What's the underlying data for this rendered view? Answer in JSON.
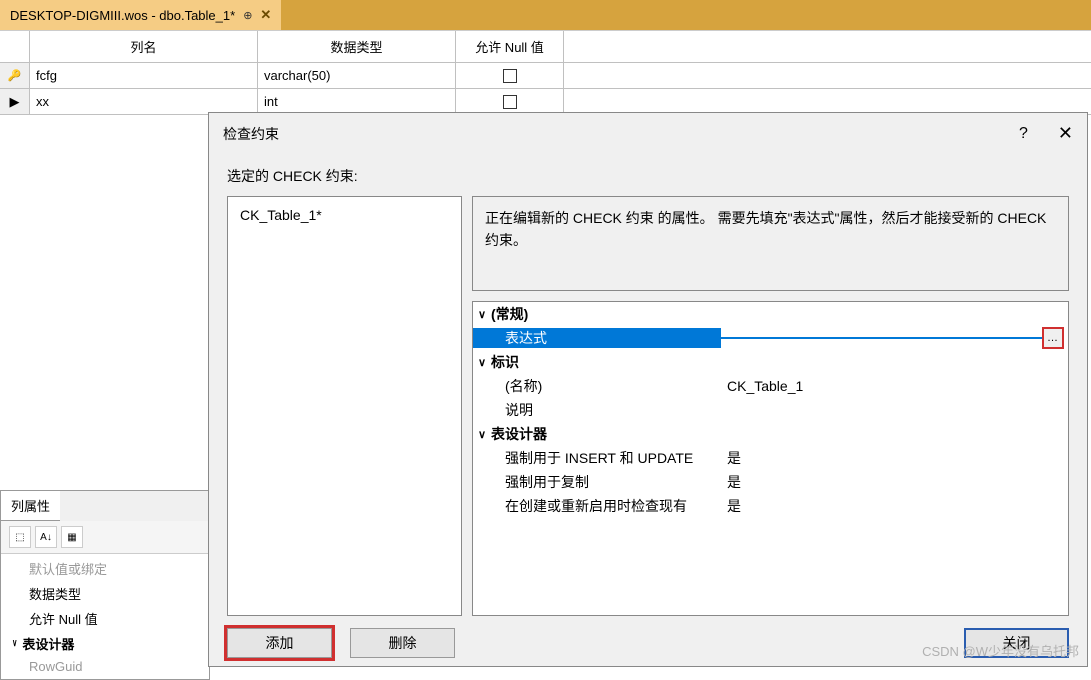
{
  "tab": {
    "title": "DESKTOP-DIGMIII.wos - dbo.Table_1*",
    "pin_glyph": "⊕",
    "close_glyph": "✕"
  },
  "grid": {
    "headers": {
      "name": "列名",
      "type": "数据类型",
      "null": "允许 Null 值"
    },
    "rows": [
      {
        "selector": "key",
        "name": "fcfg",
        "type": "varchar(50)",
        "null": false
      },
      {
        "selector": "arrow",
        "name": "xx",
        "type": "int",
        "null": false
      }
    ]
  },
  "col_props": {
    "tab_label": "列属性",
    "toolbar": {
      "cat_glyph": "⬚",
      "sort_glyph": "A↓",
      "pages_glyph": "▦"
    },
    "items": [
      {
        "label": "默认值或绑定",
        "kind": "disabled"
      },
      {
        "label": "数据类型",
        "kind": "normal"
      },
      {
        "label": "允许 Null 值",
        "kind": "normal"
      },
      {
        "label": "表设计器",
        "kind": "group"
      },
      {
        "label": "RowGuid",
        "kind": "disabled"
      }
    ]
  },
  "dialog": {
    "title": "检查约束",
    "help_glyph": "?",
    "close_glyph": "✕",
    "section_label": "选定的 CHECK 约束:",
    "constraint_items": [
      "CK_Table_1*"
    ],
    "description": "正在编辑新的 CHECK 约束 的属性。  需要先填充\"表达式\"属性，然后才能接受新的 CHECK 约束。",
    "props": [
      {
        "type": "group",
        "label": "(常规)"
      },
      {
        "type": "selected",
        "label": "表达式",
        "value": ""
      },
      {
        "type": "group",
        "label": "标识"
      },
      {
        "type": "item",
        "label": "(名称)",
        "value": "CK_Table_1"
      },
      {
        "type": "item",
        "label": "说明",
        "value": ""
      },
      {
        "type": "group",
        "label": "表设计器"
      },
      {
        "type": "item",
        "label": "强制用于 INSERT 和 UPDATE",
        "value": "是"
      },
      {
        "type": "item",
        "label": "强制用于复制",
        "value": "是"
      },
      {
        "type": "item",
        "label": "在创建或重新启用时检查现有",
        "value": "是"
      }
    ],
    "ellipsis_glyph": "…",
    "buttons": {
      "add": "添加",
      "delete": "删除",
      "close": "关闭"
    }
  },
  "watermark": "CSDN @W少年没有乌托邦"
}
